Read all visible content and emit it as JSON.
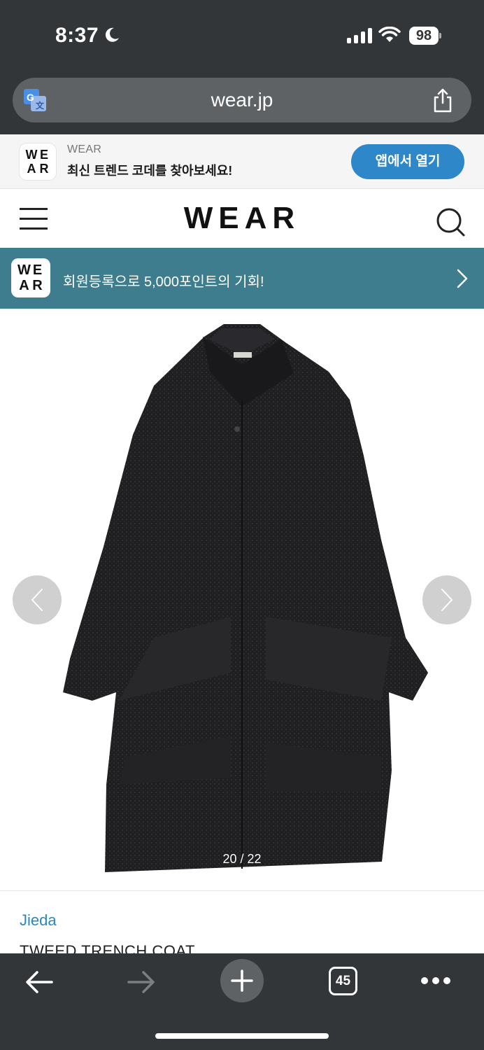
{
  "status_bar": {
    "time": "8:37",
    "battery": "98"
  },
  "address_bar": {
    "url": "wear.jp"
  },
  "app_banner": {
    "logo_letters": [
      "W",
      "E",
      "A",
      "R"
    ],
    "brand": "WEAR",
    "tagline": "최신 트렌드 코데를 찾아보세요!",
    "open_button": "앱에서 열기"
  },
  "header": {
    "logo": "WEAR"
  },
  "promo": {
    "logo_letters": [
      "W",
      "E",
      "A",
      "R"
    ],
    "text": "회원등록으로 5,000포인트의 기회!"
  },
  "gallery": {
    "counter": "20 / 22"
  },
  "product": {
    "brand": "Jieda",
    "title": "TWEED TRENCH COAT"
  },
  "toolbar": {
    "tab_count": "45"
  },
  "colors": {
    "chrome": "#333638",
    "address_pill": "#5f6264",
    "accent_blue": "#2d87c8",
    "promo_teal": "#3e7d8d",
    "brand_link": "#2a87c0"
  }
}
